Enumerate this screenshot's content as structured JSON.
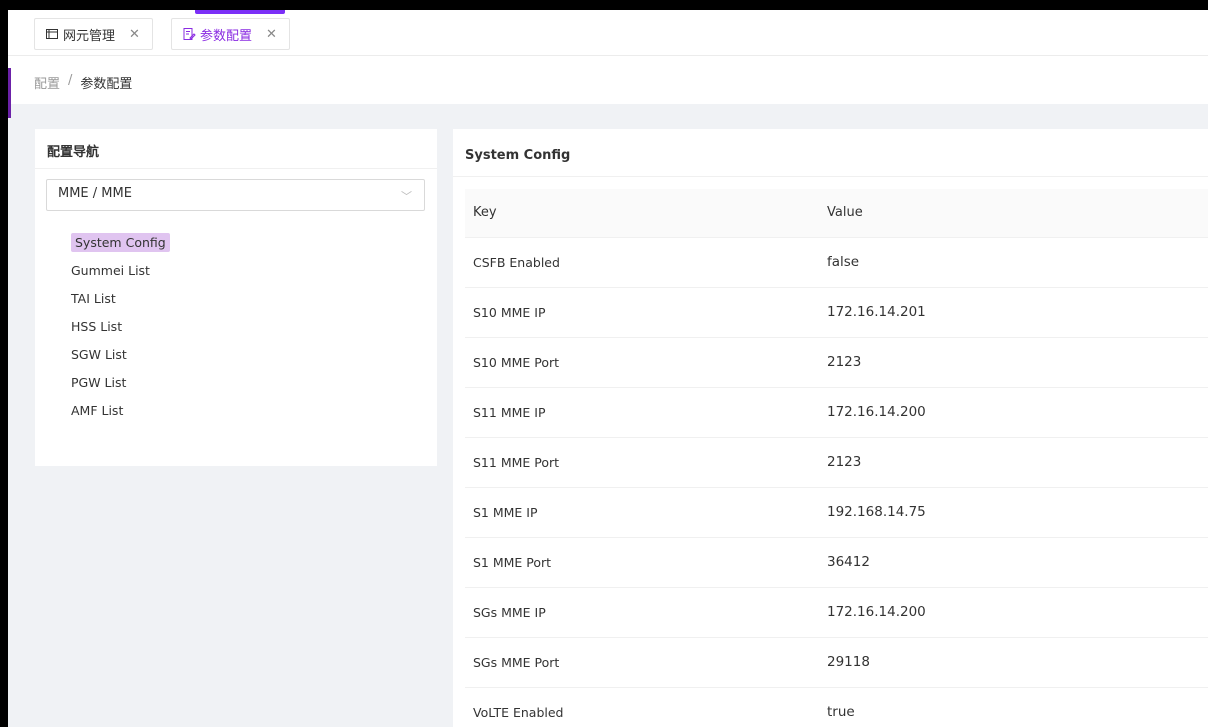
{
  "tabs": [
    {
      "label": "网元管理",
      "icon": "folder-icon",
      "active": false
    },
    {
      "label": "参数配置",
      "icon": "edit-doc-icon",
      "active": true
    }
  ],
  "accent_color": "#7b2ff7",
  "breadcrumb": {
    "parent": "配置",
    "separator": "/",
    "current": "参数配置"
  },
  "config_nav": {
    "title": "配置导航",
    "selected_value": "MME / MME",
    "items": [
      {
        "label": "System Config",
        "active": true
      },
      {
        "label": "Gummei List"
      },
      {
        "label": "TAI List"
      },
      {
        "label": "HSS List"
      },
      {
        "label": "SGW List"
      },
      {
        "label": "PGW List"
      },
      {
        "label": "AMF List"
      }
    ]
  },
  "system_config": {
    "title": "System Config",
    "columns": [
      "Key",
      "Value"
    ],
    "rows": [
      {
        "key": "CSFB Enabled",
        "value": "false"
      },
      {
        "key": "S10 MME IP",
        "value": "172.16.14.201"
      },
      {
        "key": "S10 MME Port",
        "value": "2123"
      },
      {
        "key": "S11 MME IP",
        "value": "172.16.14.200"
      },
      {
        "key": "S11 MME Port",
        "value": "2123"
      },
      {
        "key": "S1 MME IP",
        "value": "192.168.14.75"
      },
      {
        "key": "S1 MME Port",
        "value": "36412"
      },
      {
        "key": "SGs MME IP",
        "value": "172.16.14.200"
      },
      {
        "key": "SGs MME Port",
        "value": "29118"
      },
      {
        "key": "VoLTE Enabled",
        "value": "true"
      }
    ]
  }
}
